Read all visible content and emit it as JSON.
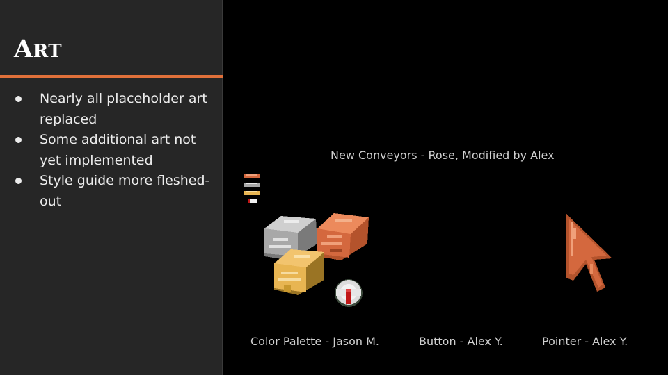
{
  "slide": {
    "title_initial": "A",
    "title_rest": "RT",
    "bullets": [
      "Nearly all placeholder art replaced",
      "Some additional art not yet implemented",
      "Style guide more fleshed-out"
    ]
  },
  "captions": {
    "conveyors": "New Conveyors - Rose, Modified by Alex",
    "palette": "Color Palette - Jason M.",
    "button": "Button - Alex Y.",
    "pointer": "Pointer - Alex Y."
  },
  "colors": {
    "accent": "#e0703a",
    "panel_background": "#262626",
    "background": "#000000",
    "copper": "#d4683e",
    "silver": "#a8a8a8",
    "gold": "#e8b552",
    "button_red": "#c01818"
  },
  "icons": {
    "palette_swatches": "color-palette-icon",
    "ingots": "ingot-stack-icon",
    "button": "button-icon",
    "pointer": "pointer-arrow-icon"
  }
}
